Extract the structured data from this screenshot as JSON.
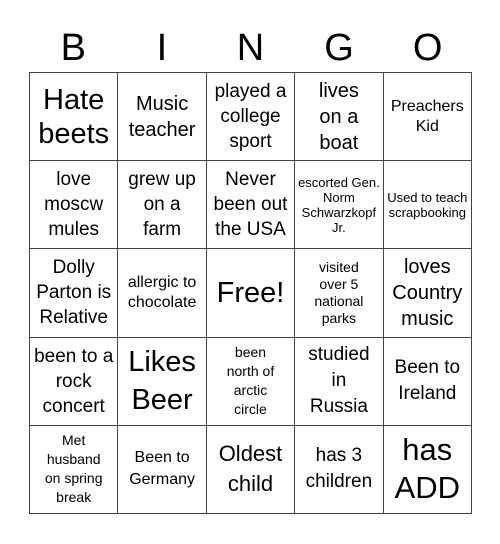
{
  "header": [
    "B",
    "I",
    "N",
    "G",
    "O"
  ],
  "cells": [
    [
      "Hate beets",
      "Music teacher",
      "played a college sport",
      "lives on a boat",
      "Preachers Kid"
    ],
    [
      "love moscw mules",
      "grew up on a farm",
      "Never been out the USA",
      "escorted Gen. Norm Schwarzkopf Jr.",
      "Used to teach scrapbooking"
    ],
    [
      "Dolly Parton is Relative",
      "allergic to chocolate",
      "Free!",
      "visited over 5 national parks",
      "loves Country music"
    ],
    [
      "been to a rock concert",
      "Likes Beer",
      "been north of arctic circle",
      "studied in Russia",
      "Been to Ireland"
    ],
    [
      "Met husband on spring break",
      "Been to Germany",
      "Oldest child",
      "has 3 children",
      "has ADD"
    ]
  ]
}
